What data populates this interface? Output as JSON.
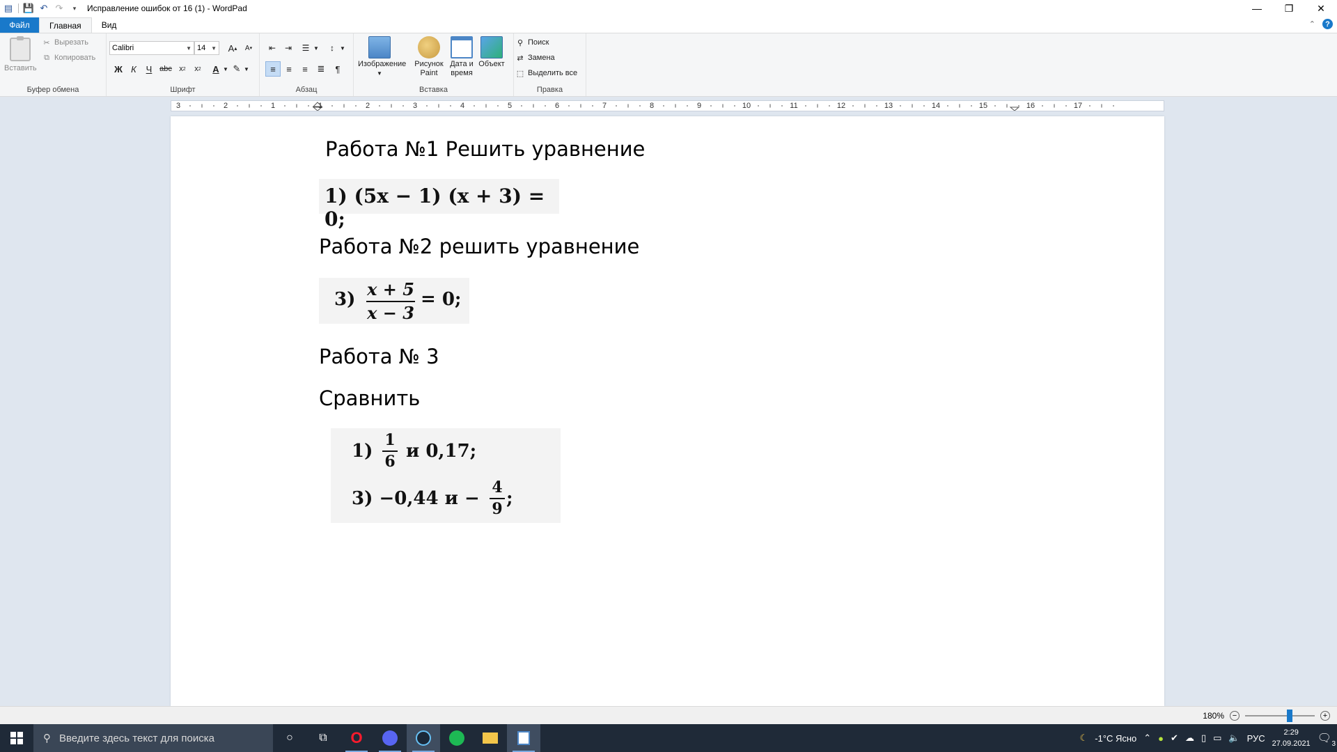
{
  "window": {
    "title": "Исправление ошибок от 16 (1) - WordPad",
    "minimize": "—",
    "restore": "❐",
    "close": "✕"
  },
  "tabs": [
    {
      "label": "Файл"
    },
    {
      "label": "Главная"
    },
    {
      "label": "Вид"
    }
  ],
  "ribbon": {
    "clipboard": {
      "paste": "Вставить",
      "cut": "Вырезать",
      "copy": "Копировать",
      "label": "Буфер обмена"
    },
    "font": {
      "family": "Calibri",
      "size": "14",
      "label": "Шрифт"
    },
    "paragraph": {
      "label": "Абзац"
    },
    "insert": {
      "image": "Изображение",
      "paint_line1": "Рисунок",
      "paint_line2": "Paint",
      "datetime_line1": "Дата и",
      "datetime_line2": "время",
      "object": "Объект",
      "label": "Вставка"
    },
    "editing": {
      "find": "Поиск",
      "replace": "Замена",
      "select_all": "Выделить все",
      "label": "Правка"
    }
  },
  "ruler": {
    "labels": [
      "3",
      "2",
      "1",
      "1",
      "2",
      "3",
      "4",
      "5",
      "6",
      "7",
      "8",
      "9",
      "10",
      "11",
      "12",
      "13",
      "14",
      "15",
      "16",
      "17"
    ]
  },
  "document": {
    "heading1": "Работа №1 Решить уравнение",
    "eq1": "1)  (5x − 1) (x + 3) = 0;",
    "heading2": "Работа №2 решить уравнение",
    "eq2_prefix": "3)",
    "eq2_num": "x + 5",
    "eq2_den": "x − 3",
    "eq2_suffix": "= 0;",
    "heading3": "Работа № 3",
    "heading4": "Сравнить",
    "eq3_prefix": "1)",
    "eq3_num": "1",
    "eq3_den": "6",
    "eq3_suffix": "и 0,17;",
    "eq4_prefix": "3)  −0,44  и  −",
    "eq4_num": "4",
    "eq4_den": "9",
    "eq4_suffix": ";"
  },
  "status": {
    "zoom": "180%",
    "zoom_level_percent": 180
  },
  "taskbar": {
    "search_placeholder": "Введите здесь текст для поиска",
    "weather": "-1°C  Ясно",
    "lang": "РУС",
    "time": "2:29",
    "date": "27.09.2021",
    "notif_count": "3"
  }
}
